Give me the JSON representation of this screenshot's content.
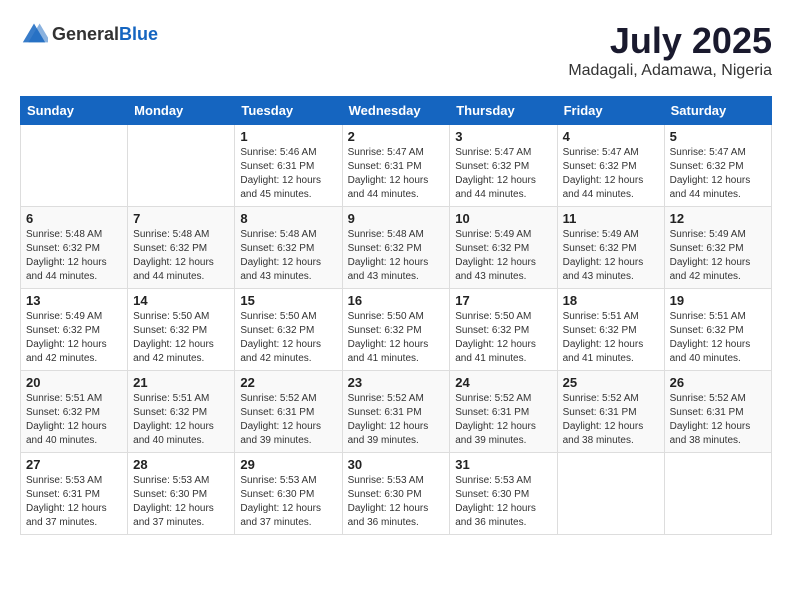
{
  "header": {
    "logo_general": "General",
    "logo_blue": "Blue",
    "month_year": "July 2025",
    "location": "Madagali, Adamawa, Nigeria"
  },
  "calendar": {
    "days_of_week": [
      "Sunday",
      "Monday",
      "Tuesday",
      "Wednesday",
      "Thursday",
      "Friday",
      "Saturday"
    ],
    "weeks": [
      [
        {
          "day": "",
          "info": ""
        },
        {
          "day": "",
          "info": ""
        },
        {
          "day": "1",
          "info": "Sunrise: 5:46 AM\nSunset: 6:31 PM\nDaylight: 12 hours and 45 minutes."
        },
        {
          "day": "2",
          "info": "Sunrise: 5:47 AM\nSunset: 6:31 PM\nDaylight: 12 hours and 44 minutes."
        },
        {
          "day": "3",
          "info": "Sunrise: 5:47 AM\nSunset: 6:32 PM\nDaylight: 12 hours and 44 minutes."
        },
        {
          "day": "4",
          "info": "Sunrise: 5:47 AM\nSunset: 6:32 PM\nDaylight: 12 hours and 44 minutes."
        },
        {
          "day": "5",
          "info": "Sunrise: 5:47 AM\nSunset: 6:32 PM\nDaylight: 12 hours and 44 minutes."
        }
      ],
      [
        {
          "day": "6",
          "info": "Sunrise: 5:48 AM\nSunset: 6:32 PM\nDaylight: 12 hours and 44 minutes."
        },
        {
          "day": "7",
          "info": "Sunrise: 5:48 AM\nSunset: 6:32 PM\nDaylight: 12 hours and 44 minutes."
        },
        {
          "day": "8",
          "info": "Sunrise: 5:48 AM\nSunset: 6:32 PM\nDaylight: 12 hours and 43 minutes."
        },
        {
          "day": "9",
          "info": "Sunrise: 5:48 AM\nSunset: 6:32 PM\nDaylight: 12 hours and 43 minutes."
        },
        {
          "day": "10",
          "info": "Sunrise: 5:49 AM\nSunset: 6:32 PM\nDaylight: 12 hours and 43 minutes."
        },
        {
          "day": "11",
          "info": "Sunrise: 5:49 AM\nSunset: 6:32 PM\nDaylight: 12 hours and 43 minutes."
        },
        {
          "day": "12",
          "info": "Sunrise: 5:49 AM\nSunset: 6:32 PM\nDaylight: 12 hours and 42 minutes."
        }
      ],
      [
        {
          "day": "13",
          "info": "Sunrise: 5:49 AM\nSunset: 6:32 PM\nDaylight: 12 hours and 42 minutes."
        },
        {
          "day": "14",
          "info": "Sunrise: 5:50 AM\nSunset: 6:32 PM\nDaylight: 12 hours and 42 minutes."
        },
        {
          "day": "15",
          "info": "Sunrise: 5:50 AM\nSunset: 6:32 PM\nDaylight: 12 hours and 42 minutes."
        },
        {
          "day": "16",
          "info": "Sunrise: 5:50 AM\nSunset: 6:32 PM\nDaylight: 12 hours and 41 minutes."
        },
        {
          "day": "17",
          "info": "Sunrise: 5:50 AM\nSunset: 6:32 PM\nDaylight: 12 hours and 41 minutes."
        },
        {
          "day": "18",
          "info": "Sunrise: 5:51 AM\nSunset: 6:32 PM\nDaylight: 12 hours and 41 minutes."
        },
        {
          "day": "19",
          "info": "Sunrise: 5:51 AM\nSunset: 6:32 PM\nDaylight: 12 hours and 40 minutes."
        }
      ],
      [
        {
          "day": "20",
          "info": "Sunrise: 5:51 AM\nSunset: 6:32 PM\nDaylight: 12 hours and 40 minutes."
        },
        {
          "day": "21",
          "info": "Sunrise: 5:51 AM\nSunset: 6:32 PM\nDaylight: 12 hours and 40 minutes."
        },
        {
          "day": "22",
          "info": "Sunrise: 5:52 AM\nSunset: 6:31 PM\nDaylight: 12 hours and 39 minutes."
        },
        {
          "day": "23",
          "info": "Sunrise: 5:52 AM\nSunset: 6:31 PM\nDaylight: 12 hours and 39 minutes."
        },
        {
          "day": "24",
          "info": "Sunrise: 5:52 AM\nSunset: 6:31 PM\nDaylight: 12 hours and 39 minutes."
        },
        {
          "day": "25",
          "info": "Sunrise: 5:52 AM\nSunset: 6:31 PM\nDaylight: 12 hours and 38 minutes."
        },
        {
          "day": "26",
          "info": "Sunrise: 5:52 AM\nSunset: 6:31 PM\nDaylight: 12 hours and 38 minutes."
        }
      ],
      [
        {
          "day": "27",
          "info": "Sunrise: 5:53 AM\nSunset: 6:31 PM\nDaylight: 12 hours and 37 minutes."
        },
        {
          "day": "28",
          "info": "Sunrise: 5:53 AM\nSunset: 6:30 PM\nDaylight: 12 hours and 37 minutes."
        },
        {
          "day": "29",
          "info": "Sunrise: 5:53 AM\nSunset: 6:30 PM\nDaylight: 12 hours and 37 minutes."
        },
        {
          "day": "30",
          "info": "Sunrise: 5:53 AM\nSunset: 6:30 PM\nDaylight: 12 hours and 36 minutes."
        },
        {
          "day": "31",
          "info": "Sunrise: 5:53 AM\nSunset: 6:30 PM\nDaylight: 12 hours and 36 minutes."
        },
        {
          "day": "",
          "info": ""
        },
        {
          "day": "",
          "info": ""
        }
      ]
    ]
  }
}
